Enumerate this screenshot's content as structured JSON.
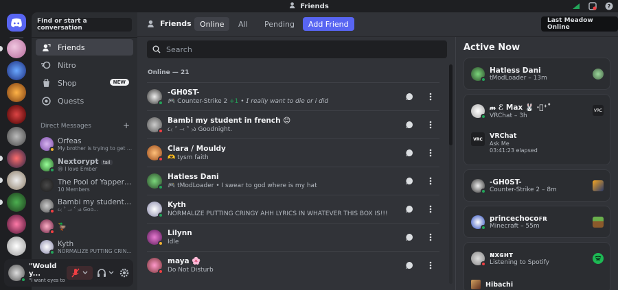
{
  "window": {
    "title": "Friends"
  },
  "sidebar": {
    "find_placeholder": "Find or start a conversation",
    "nav": [
      {
        "label": "Friends"
      },
      {
        "label": "Nitro"
      },
      {
        "label": "Shop",
        "badge": "NEW"
      },
      {
        "label": "Quests"
      }
    ],
    "dm_header": "Direct Messages",
    "dms": [
      {
        "name": "Orfeas",
        "sub": "My brother is trying to get m..."
      },
      {
        "name": "Nextorypt",
        "tag": "tail",
        "sub": "I love Ember"
      },
      {
        "name": "The Pool of Yappers: ...",
        "sub": "10 Members"
      },
      {
        "name": "Bambi my student in ...",
        "sub": "૮₍ ˃ ⤙ ˂ ₎ა Goo..."
      },
      {
        "name": "",
        "sub": ""
      },
      {
        "name": "Kyth",
        "sub": "NORMALIZE PUTTING CRIN..."
      }
    ]
  },
  "user": {
    "name": "\"Would y...",
    "status": "\"I want eyes to..."
  },
  "header": {
    "title": "Friends",
    "tabs": [
      "Online",
      "All",
      "Pending"
    ],
    "add_friend": "Add Friend",
    "tooltip": "Last Meadow Online"
  },
  "friends": {
    "search_placeholder": "Search",
    "online_label": "Online — 21",
    "list": [
      {
        "name": "-GH0ST-",
        "activity": "Counter-Strike 2",
        "plus": "+1",
        "note": "• 𝘐 𝘳𝘦𝘢𝘭𝘭𝘺 𝘸𝘢𝘯𝘵 𝘵𝘰 𝘥𝘪𝘦 𝘰𝘳 𝘪 𝘥𝘪𝘥"
      },
      {
        "name": "Bambi my student in french 😊",
        "activity": "૮₍ ˃ ⤙ ˂ ₎ა Goodnight.",
        "plus": "",
        "note": ""
      },
      {
        "name": "Clara / Mouldy",
        "activity": "tysm faith",
        "plus": "",
        "note": ""
      },
      {
        "name": "Hatless Dani",
        "activity": "tModLoader",
        "plus": "",
        "note": "• I swear to god where is my hat"
      },
      {
        "name": "Kyth",
        "activity": "NORMALIZE PUTTING CRINGY AHH LYRICS IN WHATEVER THIS BOX IS!!!",
        "plus": "",
        "note": ""
      },
      {
        "name": "Lilynn",
        "activity": "Idle",
        "plus": "",
        "note": ""
      },
      {
        "name": "maya 🌸",
        "activity": "Do Not Disturb",
        "plus": "",
        "note": ""
      }
    ]
  },
  "active_now": {
    "title": "Active Now",
    "cards": [
      {
        "name": "Hatless Dani",
        "sub": "tModLoader – 13m"
      },
      {
        "name": "𝓂 ℰ Max 🐰 ‧͙⁺˚",
        "sub": "VRChat – 3h",
        "detail_title": "VRChat",
        "detail_sub": "Ask Me",
        "detail_time": "03:41:23 elapsed",
        "vrc_label": "VRC"
      },
      {
        "name": "-GH0ST-",
        "sub": "Counter-Strike 2 – 8m"
      },
      {
        "name": "princechocᴏꜰʀ",
        "sub": "Minecraft – 55m"
      },
      {
        "name": "ɴxɢʜᴛ",
        "sub": "Listening to Spotify",
        "next": "Hibachi"
      }
    ]
  },
  "colors": {
    "blurple": "#5865f2",
    "online": "#23a55a",
    "idle": "#f0b232",
    "dnd": "#f23f43"
  }
}
